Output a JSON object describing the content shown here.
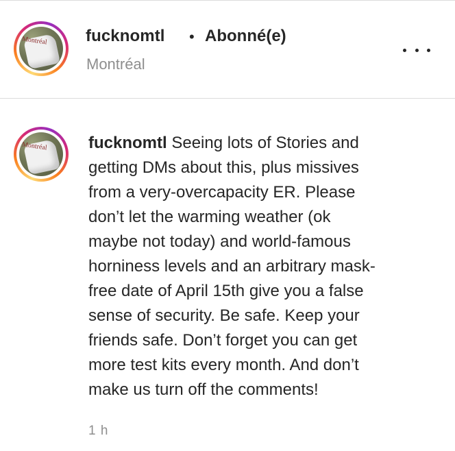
{
  "header": {
    "username": "fucknomtl",
    "separator": "•",
    "follow_status": "Abonné(e)",
    "location": "Montréal",
    "more_icon": "more-horizontal-icon"
  },
  "post": {
    "username": "fucknomtl",
    "caption_lines": [
      "Seeing lots of Stories and",
      "getting DMs about this, plus missives",
      "from a very-overcapacity ER. Please",
      "don’t let the warming weather (ok",
      "maybe not today) and world-famous",
      "horniness levels and an arbitrary mask-",
      "free date of April 15th give you a false",
      "sense of security. Be safe. Keep your",
      "friends safe. Don’t forget you can get",
      "more test kits every month. And don’t",
      "make us turn off the comments!"
    ],
    "timestamp": "1 h"
  },
  "avatar": {
    "bag_text": "Montréal"
  }
}
